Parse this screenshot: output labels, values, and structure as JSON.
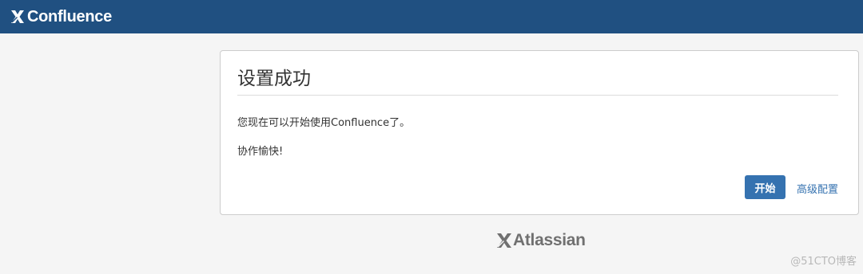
{
  "header": {
    "product_name": "Confluence",
    "logo_icon": "confluence-x-icon",
    "background_color": "#205081"
  },
  "panel": {
    "title": "设置成功",
    "message_1": "您现在可以开始使用Confluence了。",
    "message_2": "协作愉快!",
    "primary_button_label": "开始",
    "secondary_link_label": "高级配置",
    "accent_color": "#3572b0"
  },
  "footer": {
    "logo_text": "Atlassian",
    "logo_icon": "atlassian-x-icon"
  },
  "watermark": {
    "text": "@51CTO博客"
  }
}
